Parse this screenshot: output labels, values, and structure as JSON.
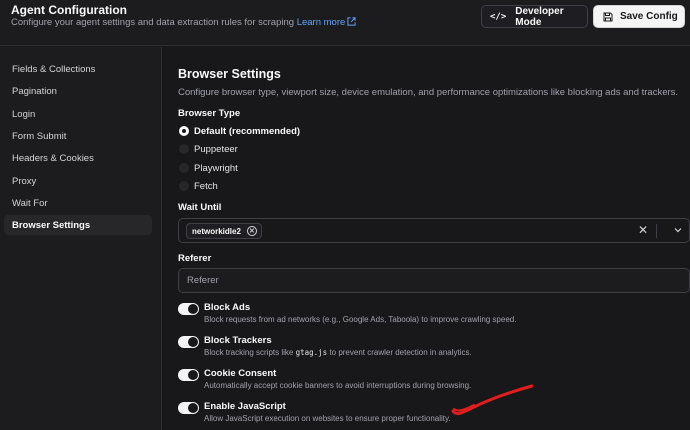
{
  "header": {
    "title": "Agent Configuration",
    "subtitle": "Configure your agent settings and data extraction rules for scraping",
    "learn_more": "Learn more",
    "developer_mode_label": "Developer Mode",
    "save_label": "Save Config"
  },
  "sidebar": {
    "items": [
      {
        "label": "Fields & Collections",
        "active": false
      },
      {
        "label": "Pagination",
        "active": false
      },
      {
        "label": "Login",
        "active": false
      },
      {
        "label": "Form Submit",
        "active": false
      },
      {
        "label": "Headers & Cookies",
        "active": false
      },
      {
        "label": "Proxy",
        "active": false
      },
      {
        "label": "Wait For",
        "active": false
      },
      {
        "label": "Browser Settings",
        "active": true
      }
    ]
  },
  "main": {
    "title": "Browser Settings",
    "description": "Configure browser type, viewport size, device emulation, and performance optimizations like blocking ads and trackers.",
    "browser_type": {
      "label": "Browser Type",
      "options": [
        "Default (recommended)",
        "Puppeteer",
        "Playwright",
        "Fetch"
      ],
      "selected": "Default (recommended)"
    },
    "wait_until": {
      "label": "Wait Until",
      "chips": [
        "networkidle2"
      ]
    },
    "referer": {
      "label": "Referer",
      "value": "",
      "placeholder": "Referer"
    },
    "toggles": [
      {
        "title": "Block Ads",
        "desc": "Block requests from ad networks (e.g., Google Ads, Taboola) to improve crawling speed.",
        "on": true
      },
      {
        "title": "Block Trackers",
        "desc_before": "Block tracking scripts like ",
        "desc_code": "gtag.js",
        "desc_after": " to prevent crawler detection in analytics.",
        "on": true
      },
      {
        "title": "Cookie Consent",
        "desc": "Automatically accept cookie banners to avoid interruptions during browsing.",
        "on": true
      },
      {
        "title": "Enable JavaScript",
        "desc": "Allow JavaScript execution on websites to ensure proper functionality.",
        "on": true
      }
    ]
  },
  "colors": {
    "background": "#18181b",
    "panel": "#1c1c1f",
    "link": "#60a5fa",
    "annotation_stroke": "#e11d1d"
  },
  "icons": [
    "code-icon",
    "save-icon",
    "external-link-icon",
    "close-icon",
    "chevron-down-icon"
  ]
}
